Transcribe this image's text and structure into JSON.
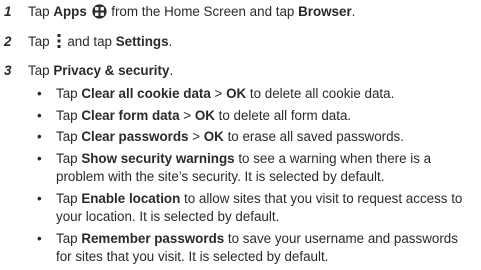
{
  "steps": [
    {
      "number": "1",
      "t1": "Tap ",
      "b1": "Apps",
      "icon": "apps-grid-icon",
      "t2": " from the Home Screen and tap ",
      "b2": "Browser",
      "t3": "."
    },
    {
      "number": "2",
      "t1": "Tap ",
      "icon": "menu-more-icon",
      "t2": "and tap ",
      "b1": "Settings",
      "t3": "."
    },
    {
      "number": "3",
      "t1": "Tap ",
      "b1": "Privacy & security",
      "t2": ".",
      "bullets": [
        {
          "bullet": "•",
          "t1": "Tap ",
          "b1": "Clear all cookie data",
          "t2": " > ",
          "b2": "OK",
          "t3": " to delete all cookie data."
        },
        {
          "bullet": "•",
          "t1": "Tap ",
          "b1": "Clear form data",
          "t2": " > ",
          "b2": "OK",
          "t3": " to delete all form data."
        },
        {
          "bullet": "•",
          "t1": "Tap ",
          "b1": "Clear passwords",
          "t2": " > ",
          "b2": "OK",
          "t3": " to erase all saved passwords."
        },
        {
          "bullet": "•",
          "t1": "Tap ",
          "b1": "Show security warnings",
          "t2": " to see a warning when there is a problem with the site’s security. It is selected by default."
        },
        {
          "bullet": "•",
          "t1": "Tap ",
          "b1": "Enable location",
          "t2": " to allow sites that you visit to request access to your location. It is selected by default."
        },
        {
          "bullet": "•",
          "t1": "Tap ",
          "b1": "Remember passwords",
          "t2": " to save your username and passwords for sites that you visit. It is selected by default."
        }
      ]
    }
  ]
}
